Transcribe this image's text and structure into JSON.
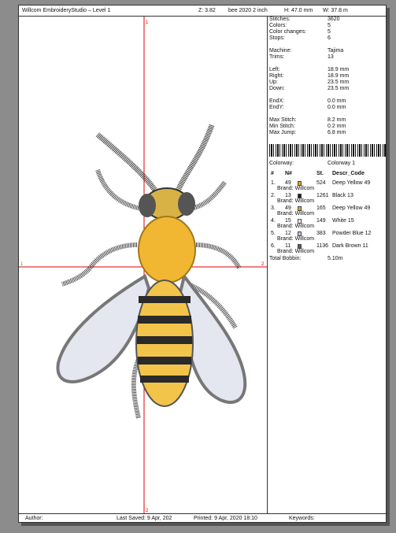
{
  "header": {
    "title": "Willcom EmbroideryStudio – Level 1",
    "zoom": "Z: 3.82",
    "bee_label": "bee 2020 2 inch",
    "height": "H: 47.0 mm",
    "width": "W: 37.8 m"
  },
  "stats": [
    {
      "label": "Stitches:",
      "value": "3620"
    },
    {
      "label": "Colors:",
      "value": "5"
    },
    {
      "label": "Color changes:",
      "value": "5"
    },
    {
      "label": "Stops:",
      "value": "6"
    }
  ],
  "machine": [
    {
      "label": "Machine:",
      "value": "Tajima"
    },
    {
      "label": "Trims:",
      "value": "13"
    }
  ],
  "extents": [
    {
      "label": "Left:",
      "value": "18.9 mm"
    },
    {
      "label": "Right:",
      "value": "18.9 mm"
    },
    {
      "label": "Up:",
      "value": "23.5 mm"
    },
    {
      "label": "Down:",
      "value": "23.5 mm"
    }
  ],
  "end": [
    {
      "label": "EndX:",
      "value": "0.0 mm"
    },
    {
      "label": "EndY:",
      "value": "0.0 mm"
    }
  ],
  "stitchinfo": [
    {
      "label": "Max Stitch:",
      "value": "8.2 mm"
    },
    {
      "label": "Min Stitch:",
      "value": "0.2 mm"
    },
    {
      "label": "Max Jump:",
      "value": "6.8 mm"
    }
  ],
  "colorway": {
    "label": "Colorway:",
    "value": "Colorway 1"
  },
  "table_headers": {
    "num": "#",
    "n": "N#",
    "st": "St.",
    "desc": "Descr_Code"
  },
  "threads": [
    {
      "idx": "1.",
      "n": "49",
      "st": "524",
      "desc": "Deep Yellow 49",
      "brand": "Brand: Willcom",
      "color": "#d9a73a"
    },
    {
      "idx": "2.",
      "n": "13",
      "st": "1261",
      "desc": "Black 13",
      "brand": "Brand: Willcom",
      "color": "#222222"
    },
    {
      "idx": "3.",
      "n": "49",
      "st": "165",
      "desc": "Deep Yellow 49",
      "brand": "Brand: Willcom",
      "color": "#d9a73a"
    },
    {
      "idx": "4.",
      "n": "15",
      "st": "149",
      "desc": "White 15",
      "brand": "Brand: Willcom",
      "color": "#ffffff"
    },
    {
      "idx": "5.",
      "n": "12",
      "st": "383",
      "desc": "Powder Blue 12",
      "brand": "Brand: Willcom",
      "color": "#b8c6e3"
    },
    {
      "idx": "6.",
      "n": "11",
      "st": "1136",
      "desc": "Dark Brown 11",
      "brand": "Brand: Willcom",
      "color": "#6b5a4a"
    }
  ],
  "bobbin": {
    "label": "Total Bobbin:",
    "value": "5.10m"
  },
  "footer": {
    "author": "Author:",
    "saved": "Last Saved:  9 Apr, 202",
    "printed": "Printed:  9 Apr, 2020 18:10",
    "keywords": "Keywords:"
  },
  "axis_marks": {
    "top": "1",
    "left": "1",
    "right": "2",
    "bottom": "2"
  }
}
